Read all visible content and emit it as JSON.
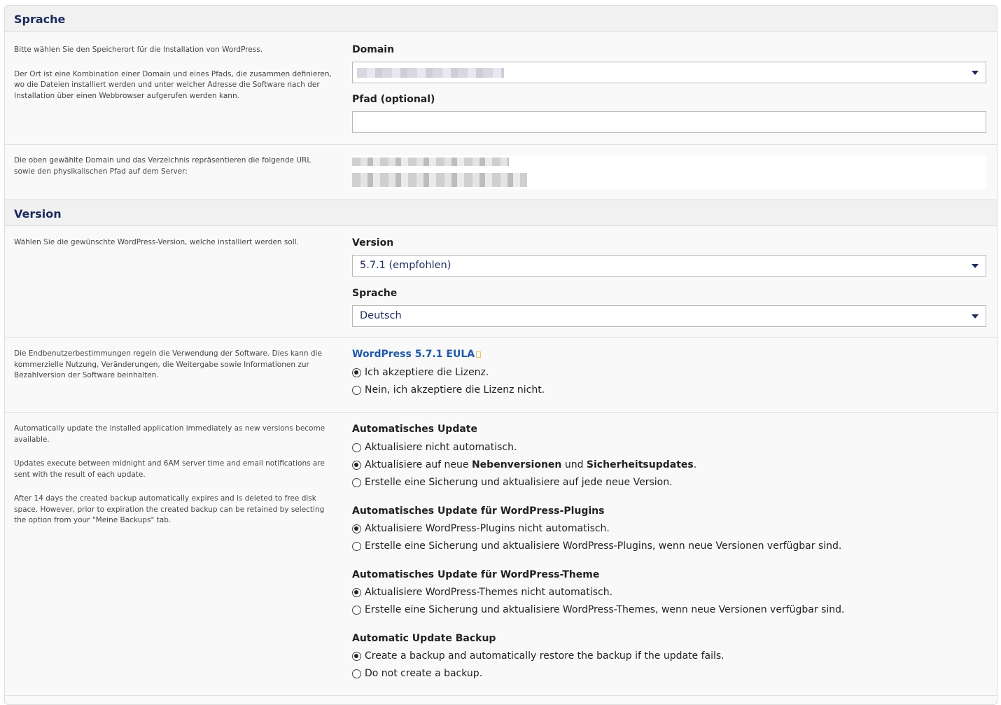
{
  "sections": {
    "sprache": {
      "title": "Sprache",
      "help": [
        "Bitte wählen Sie den Speicherort für die Installation von WordPress.",
        "Der Ort ist eine Kombination einer Domain und eines Pfads, die zusammen definieren, wo die Dateien installiert werden und unter welcher Adresse die Software nach der Installation über einen Webbrowser aufgerufen werden kann."
      ],
      "domain_label": "Domain",
      "path_label": "Pfad (optional)",
      "path_value": "",
      "url_help": "Die oben gewählte Domain und das Verzeichnis repräsentieren die folgende URL sowie den physikalischen Pfad auf dem Server:"
    },
    "version": {
      "title": "Version",
      "help": "Wählen Sie die gewünschte WordPress-Version, welche installiert werden soll.",
      "version_label": "Version",
      "version_value": "5.7.1 (empfohlen)",
      "language_label": "Sprache",
      "language_value": "Deutsch"
    },
    "eula": {
      "help": "Die Endbenutzerbestimmungen regeln die Verwendung der Software. Dies kann die kommerzielle Nutzung, Veränderungen, die Weitergabe sowie Informationen zur Bezahlversion der Software beinhalten.",
      "link": "WordPress 5.7.1 EULA",
      "options": [
        "Ich akzeptiere die Lizenz.",
        "Nein, ich akzeptiere die Lizenz nicht."
      ],
      "selected": 0
    },
    "autoupdate": {
      "help": [
        "Automatically update the installed application immediately as new versions become available.",
        "Updates execute between midnight and 6AM server time and email notifications are sent with the result of each update.",
        "After 14 days the created backup automatically expires and is deleted to free disk space. However, prior to expiration the created backup can be retained by selecting the option from your \"Meine Backups\" tab."
      ],
      "core": {
        "label": "Automatisches Update",
        "opt1": "Aktualisiere nicht automatisch.",
        "opt2_pre": "Aktualisiere auf neue ",
        "opt2_b1": "Nebenversionen",
        "opt2_mid": " und ",
        "opt2_b2": "Sicherheitsupdates",
        "opt2_post": ".",
        "opt3": "Erstelle eine Sicherung und aktualisiere auf jede neue Version.",
        "selected": 1
      },
      "plugins": {
        "label": "Automatisches Update für WordPress-Plugins",
        "options": [
          "Aktualisiere WordPress-Plugins nicht automatisch.",
          "Erstelle eine Sicherung und aktualisiere WordPress-Plugins, wenn neue Versionen verfügbar sind."
        ],
        "selected": 0
      },
      "themes": {
        "label": "Automatisches Update für WordPress-Theme",
        "options": [
          "Aktualisiere WordPress-Themes nicht automatisch.",
          "Erstelle eine Sicherung und aktualisiere WordPress-Themes, wenn neue Versionen verfügbar sind."
        ],
        "selected": 0
      },
      "backup": {
        "label": "Automatic Update Backup",
        "options": [
          "Create a backup and automatically restore the backup if the update fails.",
          "Do not create a backup."
        ],
        "selected": 0
      }
    }
  },
  "colors": {
    "heading": "#1c2a5c",
    "link": "#1e5aa8"
  }
}
